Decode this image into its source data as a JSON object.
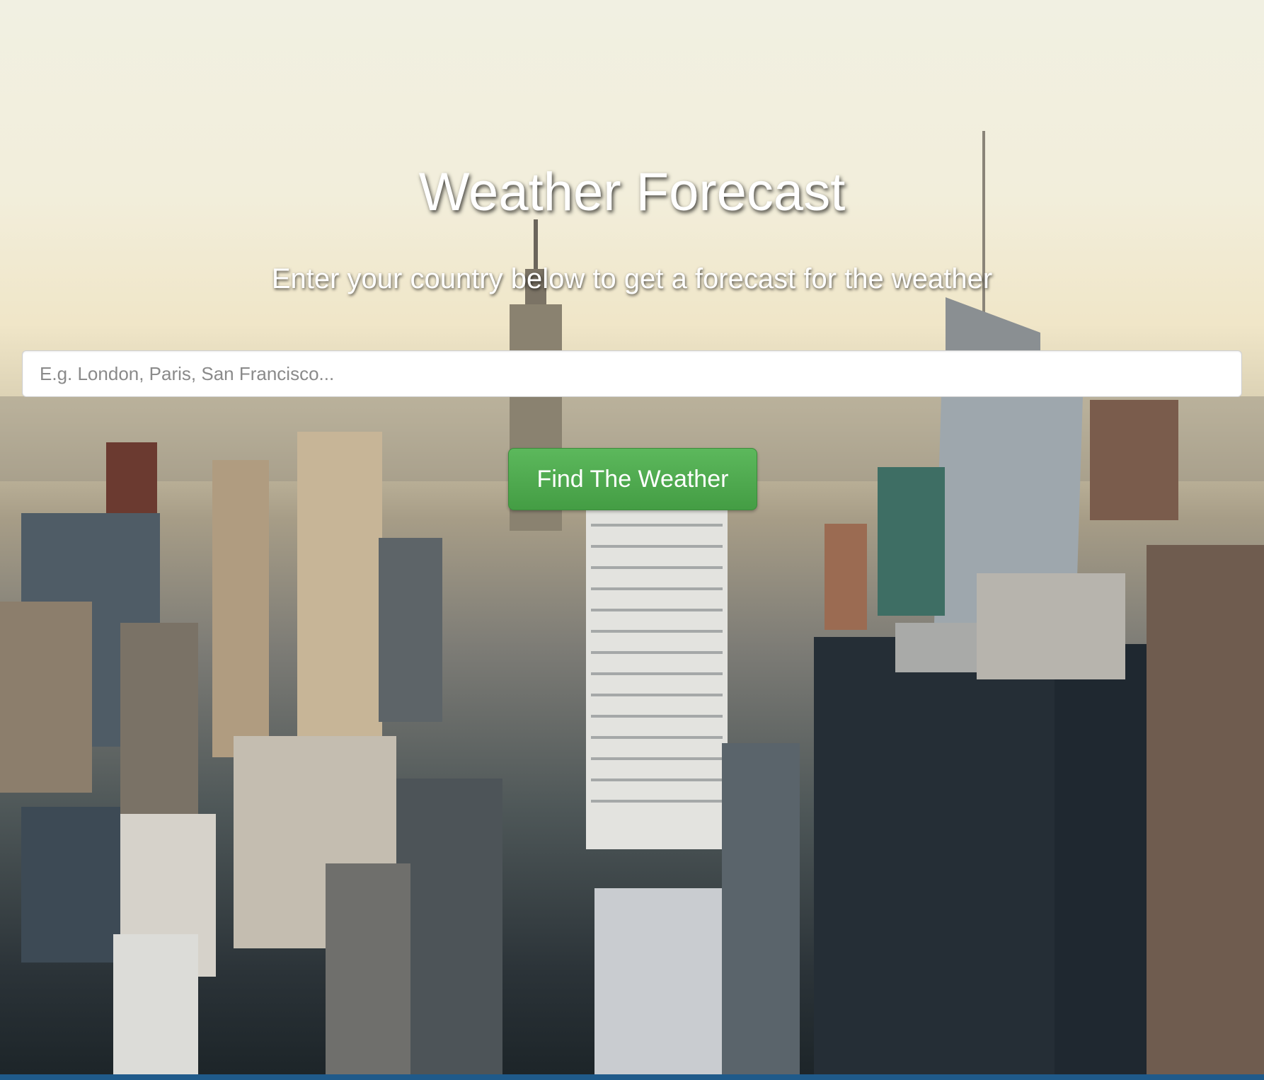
{
  "hero": {
    "title": "Weather Forecast",
    "subtitle": "Enter your country below to get a forecast for the weather"
  },
  "search": {
    "placeholder": "E.g. London, Paris, San Francisco...",
    "value": ""
  },
  "actions": {
    "find_label": "Find The Weather"
  },
  "colors": {
    "button_green": "#5cb85c",
    "status_bar": "#1f5a8a"
  }
}
